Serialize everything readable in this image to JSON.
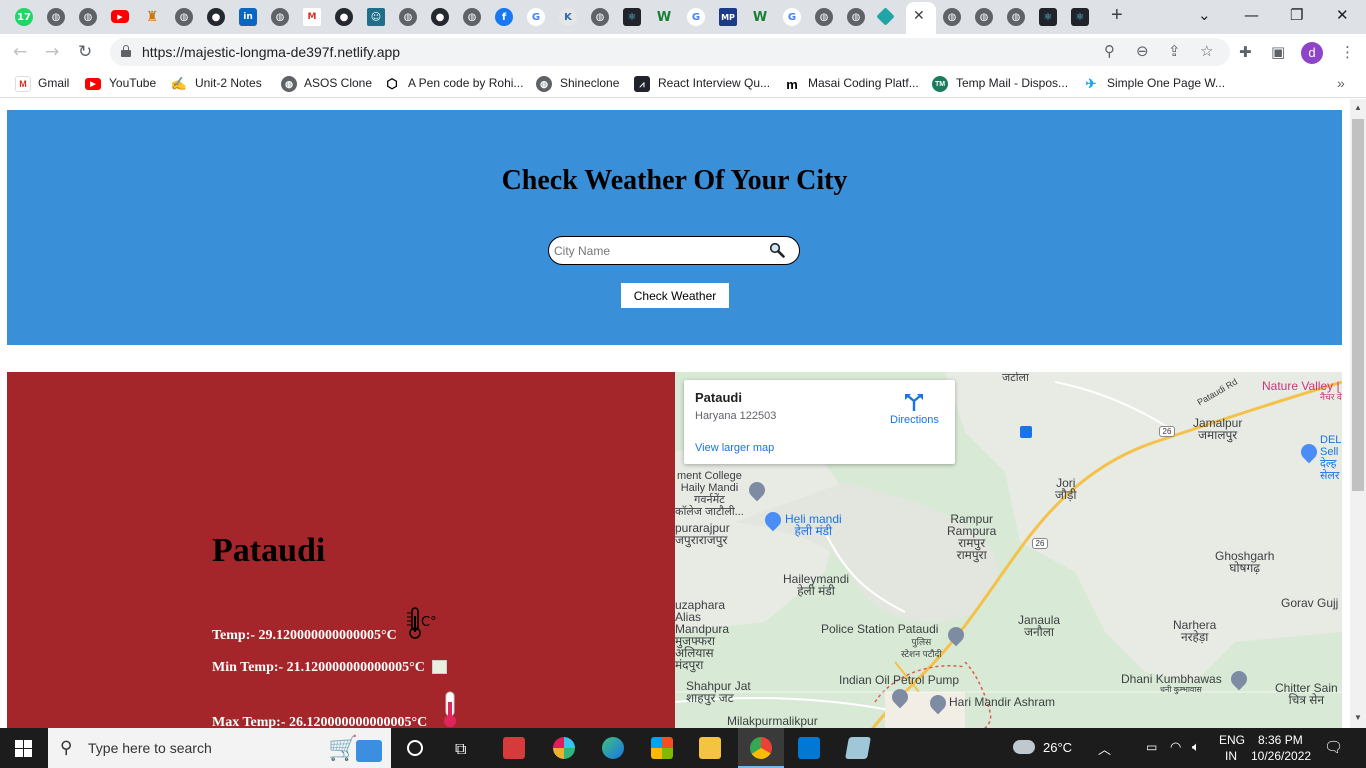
{
  "browser": {
    "url": "https://majestic-longma-de397f.netlify.app",
    "tab_badge": "17",
    "profile_initial": "d",
    "bookmarks": [
      {
        "label": "Gmail",
        "icon": "gmail-icon"
      },
      {
        "label": "YouTube",
        "icon": "youtube-icon"
      },
      {
        "label": "Unit-2 Notes",
        "icon": "notes-icon"
      },
      {
        "label": "ASOS Clone",
        "icon": "globe-icon"
      },
      {
        "label": "A Pen code by Rohi...",
        "icon": "codepen-icon"
      },
      {
        "label": "Shineclone",
        "icon": "globe-icon"
      },
      {
        "label": "React Interview Qu...",
        "icon": "react-icon"
      },
      {
        "label": "Masai Coding Platf...",
        "icon": "masai-icon"
      },
      {
        "label": "Temp Mail - Dispos...",
        "icon": "tempmail-icon"
      },
      {
        "label": "Simple One Page W...",
        "icon": "bird-icon"
      }
    ]
  },
  "page": {
    "title": "Check Weather Of Your City",
    "search_placeholder": "City Name",
    "button_label": "Check Weather",
    "city": "Pataudi",
    "temp": "Temp:- 29.120000000000005°C",
    "min_temp": "Min Temp:- 21.120000000000005°C",
    "max_temp": "Max Temp:- 26.120000000000005°C"
  },
  "map": {
    "card_title": "Pataudi",
    "card_address": "Haryana 122503",
    "directions": "Directions",
    "view_larger": "View larger map",
    "places": [
      {
        "name": "Pataudi Rd"
      },
      {
        "name": "Nature Valley |"
      },
      {
        "name": "नैचर वे"
      },
      {
        "name": "Jamalpur\nजमालपुर"
      },
      {
        "name": "DEL\nSell\nदेल्ह\nसेलर"
      },
      {
        "name": "ment College\nHaily Mandi\nगवर्नमेंट\nकॉलेज जाटौली..."
      },
      {
        "name": "Heli mandi\nहेली मंडी"
      },
      {
        "name": "Jori\nजौड़ी"
      },
      {
        "name": "purarajpur\nजपुराराजपुर"
      },
      {
        "name": "Rampur\nRampura\nरामपुर\nरामपुरा"
      },
      {
        "name": "Hailеymandi\nहेली मंडी"
      },
      {
        "name": "Ghoshgarh\nघोषगढ़"
      },
      {
        "name": "uzaphara\nAlias\nMandpura\nमुजफ्फरा\nअलियास\nमंदपुरा"
      },
      {
        "name": "Gorav Gujj"
      },
      {
        "name": "Police Station Pataudi"
      },
      {
        "name": "पुलिस\nस्टेशन पटौदी"
      },
      {
        "name": "Janaula\nजनौला"
      },
      {
        "name": "Narhera\nनरहेड़ा"
      },
      {
        "name": "Indian Oil Petrol Pump"
      },
      {
        "name": "Dhani Kumbhawas"
      },
      {
        "name": "धनी कुम्भावास"
      },
      {
        "name": "Shahpur Jat\nशाहपुर जट"
      },
      {
        "name": "Hari Mandir Ashram"
      },
      {
        "name": "Chitter Sain\nचित्र सेन"
      },
      {
        "name": "Milakpurmalikpur"
      },
      {
        "name": "जटोला"
      }
    ],
    "road_shields": [
      "26",
      "26"
    ]
  },
  "taskbar": {
    "search_placeholder": "Type here to search",
    "weather": "26°C",
    "lang": "ENG",
    "region": "IN",
    "time": "8:36 PM",
    "date": "10/26/2022"
  }
}
